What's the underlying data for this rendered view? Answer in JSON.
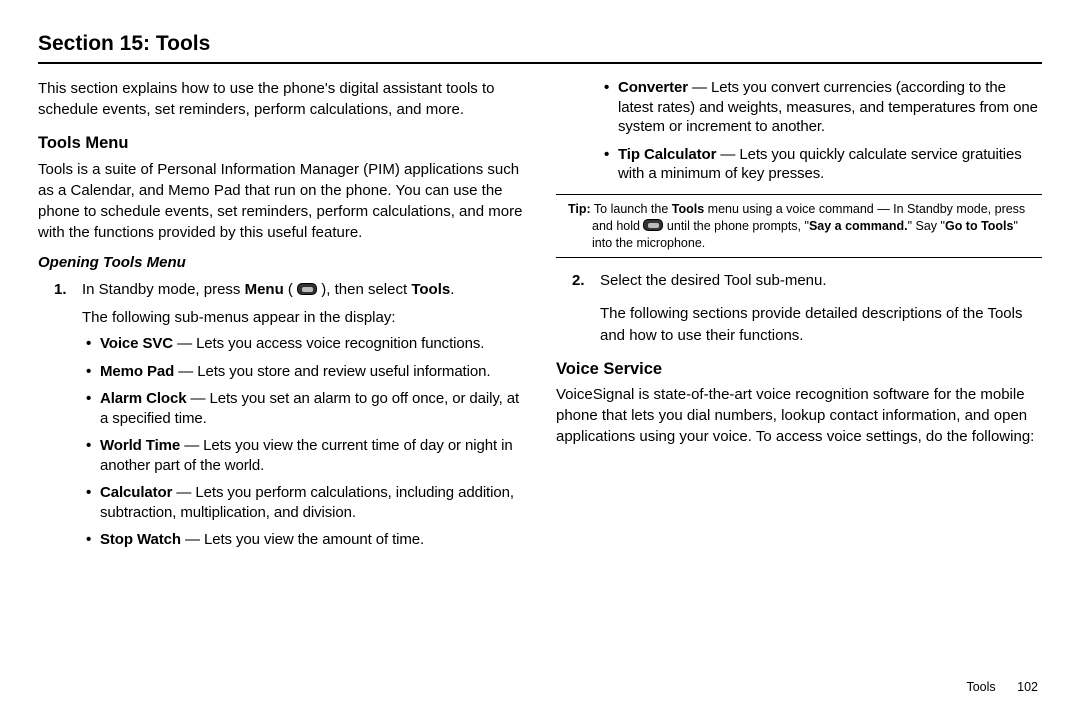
{
  "section_title": "Section 15: Tools",
  "intro": "This section explains how to use the phone's digital assistant tools to schedule events, set reminders, perform calculations, and more.",
  "tools_menu": {
    "heading": "Tools Menu",
    "body": "Tools is a suite of Personal Information Manager (PIM) applications such as a Calendar, and Memo Pad that run on the phone. You can use the phone to schedule events, set reminders, perform calculations, and more with the functions provided by this useful feature."
  },
  "opening": {
    "heading": "Opening Tools Menu",
    "step1_pre": "In Standby mode, press ",
    "step1_menu": "Menu",
    "step1_mid": " ( ",
    "step1_post": " ), then select ",
    "step1_tools": "Tools",
    "step1_end": ".",
    "step1_line2": "The following sub-menus appear in the display:",
    "bullets": [
      {
        "name": "Voice SVC",
        "desc": " — Lets you access voice recognition functions."
      },
      {
        "name": "Memo Pad",
        "desc": " — Lets you store and review useful information."
      },
      {
        "name": "Alarm Clock",
        "desc": " — Lets you set an alarm to go off once, or daily, at a specified time."
      },
      {
        "name": "World Time",
        "desc": " — Lets you view the current time of day or night in another part of the world."
      },
      {
        "name": "Calculator",
        "desc": " — Lets you perform calculations, including addition, subtraction, multiplication, and division."
      },
      {
        "name": "Stop Watch",
        "desc": " — Lets you view the amount of time."
      }
    ]
  },
  "right_bullets": [
    {
      "name": "Converter",
      "desc": " — Lets you convert currencies (according to the latest rates) and weights, measures, and temperatures from one system or increment to another."
    },
    {
      "name": "Tip Calculator",
      "desc": " — Lets you quickly calculate service gratuities with a minimum of key presses."
    }
  ],
  "tip": {
    "label": "Tip:",
    "t1": " To launch the ",
    "bold1": "Tools",
    "t2": " menu using a voice command — In Standby mode, press and hold ",
    "t3": " until the phone prompts, \"",
    "bold2": "Say a command.",
    "t4": "\" Say \"",
    "bold3": "Go to Tools",
    "t5": "\" into the microphone."
  },
  "step2": {
    "num": "2.",
    "line1": "Select the desired Tool sub-menu.",
    "line2": "The following sections provide detailed descriptions of the Tools and how to use their functions."
  },
  "voice_service": {
    "heading": "Voice Service",
    "body": "VoiceSignal is state-of-the-art voice recognition software for the mobile phone that lets you dial numbers, lookup contact information, and open applications using your voice. To access voice settings, do the following:"
  },
  "footer": {
    "label": "Tools",
    "page": "102"
  }
}
